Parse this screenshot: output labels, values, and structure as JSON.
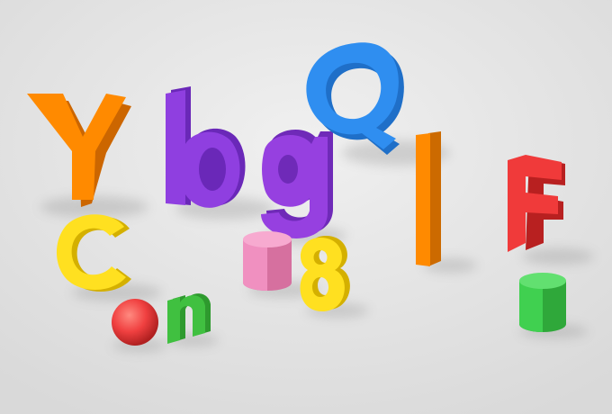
{
  "scene": {
    "background": "#e8e8e8",
    "objects": [
      {
        "kind": "letter",
        "glyph": "Y",
        "color": "#ff8a00",
        "name": "letter-y"
      },
      {
        "kind": "letter",
        "glyph": "b",
        "color": "#8f3fe0",
        "name": "letter-b"
      },
      {
        "kind": "letter",
        "glyph": "g",
        "color": "#9640e0",
        "name": "letter-g"
      },
      {
        "kind": "letter",
        "glyph": "Q",
        "color": "#2f8ef0",
        "name": "letter-q"
      },
      {
        "kind": "letter",
        "glyph": "l",
        "color": "#ff8a00",
        "name": "letter-l"
      },
      {
        "kind": "letter",
        "glyph": "F",
        "color": "#f03a3a",
        "name": "letter-f"
      },
      {
        "kind": "letter",
        "glyph": "C",
        "color": "#ffe020",
        "name": "letter-c"
      },
      {
        "kind": "letter",
        "glyph": "8",
        "color": "#ffe020",
        "name": "digit-8"
      },
      {
        "kind": "letter",
        "glyph": "n",
        "color": "#40c040",
        "name": "letter-n"
      },
      {
        "kind": "cylinder",
        "color": "#f090c0",
        "name": "pink-cylinder"
      },
      {
        "kind": "cylinder",
        "color": "#40d050",
        "name": "green-cylinder"
      },
      {
        "kind": "sphere",
        "color": "#f04040",
        "name": "red-sphere"
      }
    ]
  }
}
